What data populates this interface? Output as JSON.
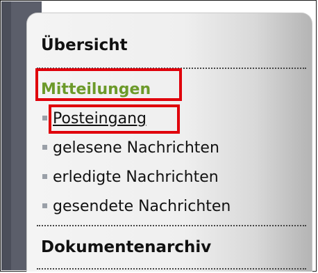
{
  "sidebar": {
    "overview_label": "Übersicht",
    "messages_label": "Mitteilungen",
    "items": [
      {
        "label": "Posteingang",
        "active": true
      },
      {
        "label": "gelesene Nachrichten",
        "active": false
      },
      {
        "label": "erledigte Nachrichten",
        "active": false
      },
      {
        "label": "gesendete Nachrichten",
        "active": false
      }
    ],
    "archive_label": "Dokumentenarchiv"
  },
  "colors": {
    "highlight": "#e0000b",
    "messages_green": "#6c9a2a",
    "band": "#5b5e6a"
  }
}
